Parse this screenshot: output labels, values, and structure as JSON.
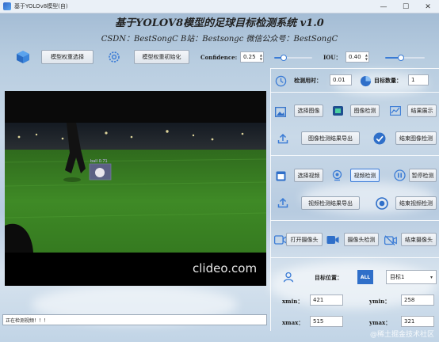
{
  "window": {
    "title": "基于YOLOv8模型(自)",
    "min": "—",
    "max": "☐",
    "close": "✕"
  },
  "header": {
    "title": "基于YOLOV8模型的足球目标检测系统 v1.0",
    "subtitle": "CSDN：BestSongC   B站：Bestsongc   微信公众号：BestSongC"
  },
  "model": {
    "select_btn": "模型权重选择",
    "init_btn": "模型权重初始化",
    "confidence_label": "Confidence:",
    "confidence_value": "0.25",
    "confidence_level": 0.25,
    "iou_label": "IOU：",
    "iou_value": "0.40",
    "iou_level": 0.4
  },
  "detect": {
    "time_label": "检测用时：",
    "time_value": "0.01",
    "count_label": "目标数量：",
    "count_value": "1"
  },
  "image": {
    "select": "选择图像",
    "detect": "图像检测",
    "show": "结果展示",
    "export": "图像检测结果导出",
    "end": "结束图像检测"
  },
  "video_ctrl": {
    "select": "选择视频",
    "detect": "视频检测",
    "pause": "暂停检测",
    "export": "视频检测结果导出",
    "end": "结束视频检测"
  },
  "camera": {
    "open": "打开摄像头",
    "detect": "摄像头检测",
    "end": "结束摄像头"
  },
  "target": {
    "pos_label": "目标位置：",
    "all_icon_text": "ALL",
    "selected": "目标1",
    "xmin_label": "xmin：",
    "xmin": "421",
    "ymin_label": "ymin：",
    "ymin": "258",
    "xmax_label": "xmax：",
    "xmax": "515",
    "ymax_label": "ymax：",
    "ymax": "321"
  },
  "video": {
    "watermark": "clideo.com",
    "det_label": "ball 0.71"
  },
  "status": {
    "text": "正在检测视频！！！"
  },
  "footer": {
    "watermark": "@稀土掘金技术社区"
  },
  "colors": {
    "accent": "#3a7bd5",
    "bg_sky": "#b8cde0",
    "det_box": "#7b4fd6"
  }
}
